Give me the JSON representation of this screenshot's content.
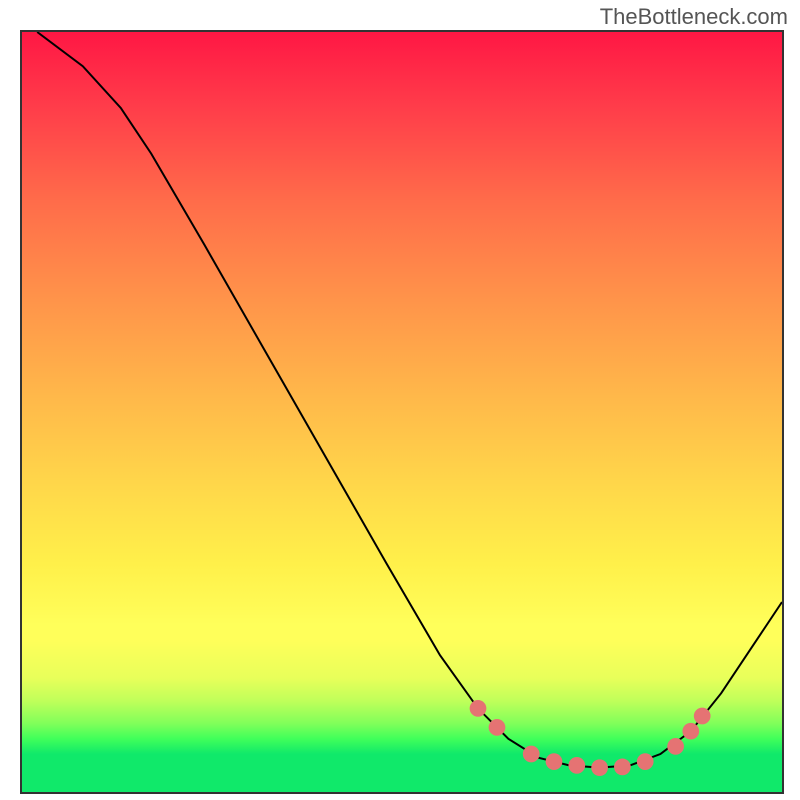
{
  "watermark": "TheBottleneck.com",
  "chart_data": {
    "type": "line",
    "title": "",
    "xlabel": "",
    "ylabel": "",
    "xlim": [
      0,
      100
    ],
    "ylim": [
      0,
      100
    ],
    "background_gradient_stops": [
      {
        "pos": 0,
        "color": "#ff1744"
      },
      {
        "pos": 50,
        "color": "#ffd84a"
      },
      {
        "pos": 80,
        "color": "#ffff5a"
      },
      {
        "pos": 95,
        "color": "#10e96a"
      }
    ],
    "series": [
      {
        "name": "curve",
        "stroke": "#000000",
        "points": [
          {
            "x": 2,
            "y": 100
          },
          {
            "x": 8,
            "y": 95.5
          },
          {
            "x": 13,
            "y": 90
          },
          {
            "x": 17,
            "y": 84
          },
          {
            "x": 24,
            "y": 72
          },
          {
            "x": 32,
            "y": 58
          },
          {
            "x": 40,
            "y": 44
          },
          {
            "x": 48,
            "y": 30
          },
          {
            "x": 55,
            "y": 18
          },
          {
            "x": 60,
            "y": 11
          },
          {
            "x": 64,
            "y": 7
          },
          {
            "x": 68,
            "y": 4.5
          },
          {
            "x": 72,
            "y": 3.5
          },
          {
            "x": 76,
            "y": 3.2
          },
          {
            "x": 80,
            "y": 3.5
          },
          {
            "x": 84,
            "y": 5
          },
          {
            "x": 88,
            "y": 8
          },
          {
            "x": 92,
            "y": 13
          },
          {
            "x": 96,
            "y": 19
          },
          {
            "x": 100,
            "y": 25
          }
        ]
      }
    ],
    "markers": [
      {
        "x": 60,
        "y": 11,
        "color": "#e57373"
      },
      {
        "x": 62.5,
        "y": 8.5,
        "color": "#e57373"
      },
      {
        "x": 67,
        "y": 5,
        "color": "#e57373"
      },
      {
        "x": 70,
        "y": 4,
        "color": "#e57373"
      },
      {
        "x": 73,
        "y": 3.5,
        "color": "#e57373"
      },
      {
        "x": 76,
        "y": 3.2,
        "color": "#e57373"
      },
      {
        "x": 79,
        "y": 3.3,
        "color": "#e57373"
      },
      {
        "x": 82,
        "y": 4,
        "color": "#e57373"
      },
      {
        "x": 86,
        "y": 6,
        "color": "#e57373"
      },
      {
        "x": 88,
        "y": 8,
        "color": "#e57373"
      },
      {
        "x": 89.5,
        "y": 10,
        "color": "#e57373"
      }
    ]
  }
}
